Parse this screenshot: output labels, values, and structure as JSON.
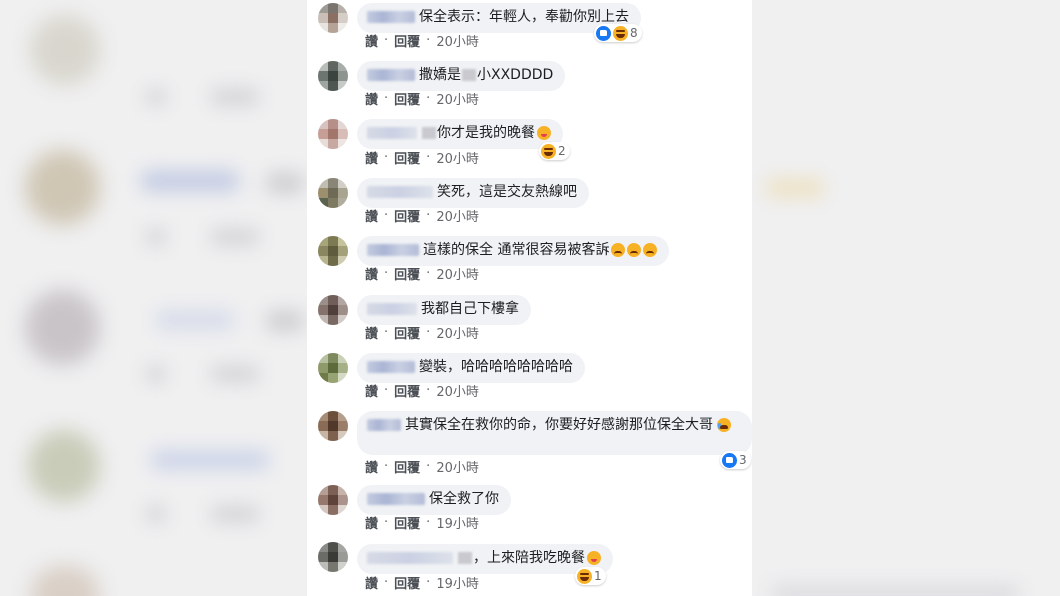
{
  "actions": {
    "like": "讚",
    "reply": "回覆"
  },
  "comments": [
    {
      "text": "保全表示：年輕人，奉勸你別上去",
      "time": "20小時",
      "reactions": {
        "count": "8",
        "icons": [
          "like-icon",
          "haha-icon"
        ]
      }
    },
    {
      "text": "撒嬌是",
      "text2": "小XXDDDD",
      "time": "20小時"
    },
    {
      "text": "你才是我的晚餐",
      "emoji": "yum-face-icon",
      "time": "20小時",
      "reactions": {
        "count": "2",
        "icons": [
          "haha-icon"
        ]
      }
    },
    {
      "text": "笑死，這是交友熱線吧",
      "time": "20小時"
    },
    {
      "text": "這樣的保全 通常很容易被客訴",
      "emoji": "sad-face-icon",
      "time": "20小時"
    },
    {
      "text": "我都自己下樓拿",
      "time": "20小時"
    },
    {
      "text": "變裝，哈哈哈哈哈哈哈哈",
      "time": "20小時"
    },
    {
      "text": "其實保全在救你的命，你要好好感謝那位保全大哥",
      "emoji": "crying-face-icon",
      "time": "20小時",
      "reactions": {
        "count": "3",
        "icons": [
          "like-icon"
        ]
      }
    },
    {
      "text": "保全救了你",
      "time": "19小時"
    },
    {
      "text": "，上來陪我吃晚餐",
      "emoji": "laughing-face-icon",
      "time": "19小時",
      "reactions": {
        "count": "1",
        "icons": [
          "haha-icon"
        ]
      }
    }
  ],
  "colors": {
    "panel_bg": "#ffffff",
    "bubble_bg": "#f0f2f5",
    "like_blue": "#1877f2",
    "emoji_yellow": "#f7b125",
    "text": "#1c1e21",
    "meta": "#65676b"
  }
}
